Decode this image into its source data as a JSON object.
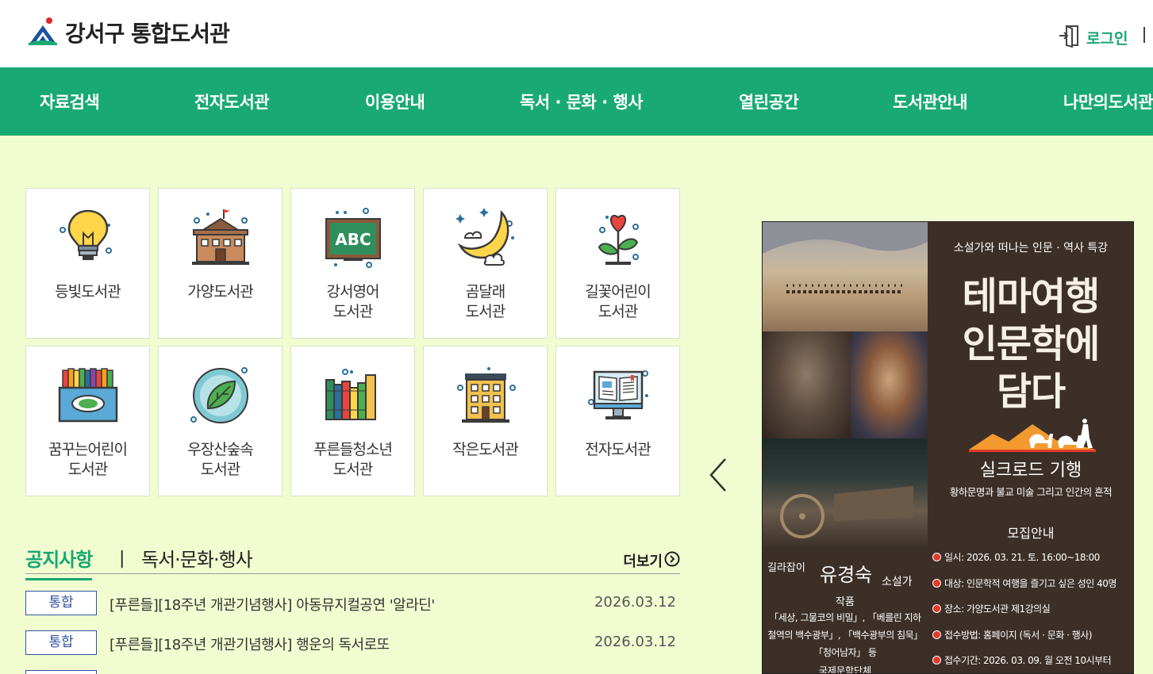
{
  "header": {
    "site_title": "강서구 통합도서관",
    "login_label": "로그인"
  },
  "nav": {
    "items": [
      {
        "label": "자료검색"
      },
      {
        "label": "전자도서관"
      },
      {
        "label": "이용안내"
      },
      {
        "label": "독서 · 문화 · 행사"
      },
      {
        "label": "열린공간"
      },
      {
        "label": "도서관안내"
      },
      {
        "label": "나만의도서관"
      }
    ]
  },
  "libraries": [
    {
      "line1": "등빛도서관",
      "line2": "",
      "icon": "lightbulb-icon"
    },
    {
      "line1": "가양도서관",
      "line2": "",
      "icon": "building-icon"
    },
    {
      "line1": "강서영어",
      "line2": "도서관",
      "icon": "abc-board-icon"
    },
    {
      "line1": "곰달래",
      "line2": "도서관",
      "icon": "moon-icon"
    },
    {
      "line1": "길꽃어린이",
      "line2": "도서관",
      "icon": "flower-icon"
    },
    {
      "line1": "꿈꾸는어린이",
      "line2": "도서관",
      "icon": "crayons-icon"
    },
    {
      "line1": "우장산숲속",
      "line2": "도서관",
      "icon": "leaf-icon"
    },
    {
      "line1": "푸른들청소년",
      "line2": "도서관",
      "icon": "books-icon"
    },
    {
      "line1": "작은도서관",
      "line2": "",
      "icon": "small-building-icon"
    },
    {
      "line1": "전자도서관",
      "line2": "",
      "icon": "monitor-icon"
    }
  ],
  "notices": {
    "tab_active": "공지사항",
    "tab_divider": "|",
    "tab_other": "독서·문화·행사",
    "more_label": "더보기",
    "rows": [
      {
        "badge": "통합",
        "title": "[푸른들][18주년 개관기념행사] 아동뮤지컬공연 '알라딘'",
        "date": "2026.03.12"
      },
      {
        "badge": "통합",
        "title": "[푸른들][18주년 개관기념행사] 행운의 독서로또",
        "date": "2026.03.12"
      }
    ]
  },
  "banner": {
    "subtitle": "소설가와 떠나는 인문 · 역사 특강",
    "title_line1": "테마여행",
    "title_line2": "인문학에",
    "title_line3": "담다",
    "road_title": "실크로드 기행",
    "road_sub": "황하문명과 불교 미술 그리고 인간의 흔적",
    "recruit_heading": "모집안내",
    "info": [
      "일시: 2026. 03. 21. 토. 16:00~18:00",
      "대상: 인문학적 여행을 즐기고 싶은 성인 40명",
      "장소: 가양도서관 제1강의실",
      "접수방법: 홈페이지 (독서 · 문화 · 행사)",
      "접수기간: 2026. 03. 09. 월 오전 10시부터"
    ],
    "guide_role": "길라잡이",
    "guide_name": "유경숙",
    "guide_job": "소설가",
    "works_heading": "작품",
    "works_text": "「세상, 그물코의 비밀」, 「베를린 지하철역의 백수광부」, 「백수광부의 침묵」 「청어남자」 등",
    "award_text": "국제문학단체"
  },
  "colors": {
    "brand_green": "#19a974",
    "page_background": "#f1fdd0",
    "badge_blue": "#2f53a3",
    "poster_brown": "#3c2f28"
  }
}
